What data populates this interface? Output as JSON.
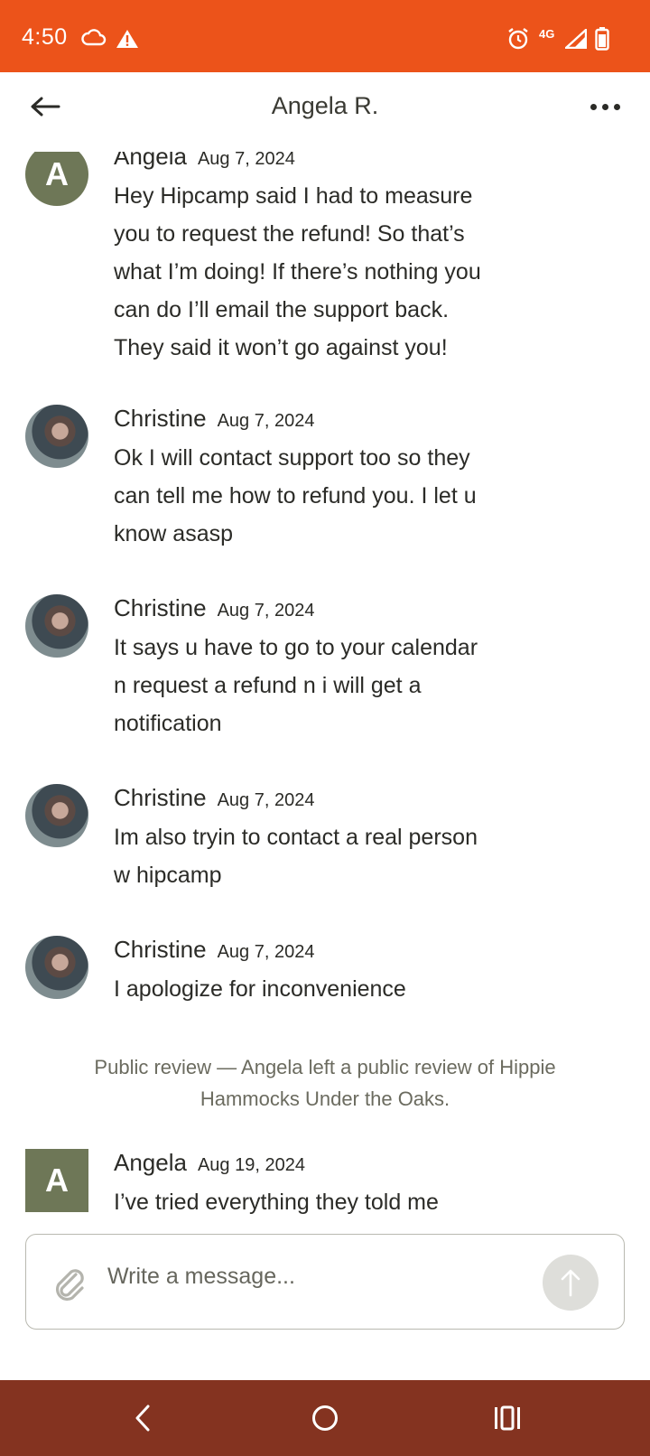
{
  "status_bar": {
    "time": "4:50",
    "network_label": "4G",
    "color": "#ec531a",
    "icons": [
      "cloud-icon",
      "warning-icon",
      "alarm-icon",
      "signal-icon",
      "battery-icon"
    ]
  },
  "header": {
    "title": "Angela R.",
    "back_icon": "arrow-left-icon",
    "more_icon": "more-horizontal-icon"
  },
  "messages": [
    {
      "author": "Angela",
      "date": "Aug 7, 2024",
      "avatar_letter": "A",
      "avatar_type": "letter-circle",
      "lines": [
        "Hey Hipcamp said I had to measure",
        "you to request the refund! So that’s",
        "what I’m doing! If there’s nothing you",
        "can do I’ll email the support back.",
        "They said it won’t go against you!"
      ]
    },
    {
      "author": "Christine",
      "date": "Aug 7, 2024",
      "avatar_type": "photo",
      "lines": [
        "Ok I will contact support too so they",
        "can tell me how to refund you. I let u",
        "know asasp"
      ]
    },
    {
      "author": "Christine",
      "date": "Aug 7, 2024",
      "avatar_type": "photo",
      "lines": [
        "It says u have to go to your calendar",
        "n request a refund n i will get a",
        "notification"
      ]
    },
    {
      "author": "Christine",
      "date": "Aug 7, 2024",
      "avatar_type": "photo",
      "lines": [
        "Im also tryin to contact a real person",
        "w hipcamp"
      ]
    },
    {
      "author": "Christine",
      "date": "Aug 7, 2024",
      "avatar_type": "photo",
      "lines": [
        "I apologize for inconvenience"
      ]
    },
    {
      "author": "Angela",
      "date": "Aug 19, 2024",
      "avatar_letter": "A",
      "avatar_type": "letter-square",
      "lines": [
        "I’ve tried everything they told me"
      ]
    }
  ],
  "system_note": {
    "line1": "Public review — Angela left a public review of Hippie",
    "line2": "Hammocks Under the Oaks."
  },
  "composer": {
    "placeholder": "Write a message...",
    "attach_icon": "paperclip-icon",
    "send_icon": "arrow-up-icon"
  },
  "nav_bar": {
    "color": "#843320",
    "buttons": [
      "back-nav-icon",
      "home-nav-icon",
      "recents-nav-icon"
    ]
  }
}
